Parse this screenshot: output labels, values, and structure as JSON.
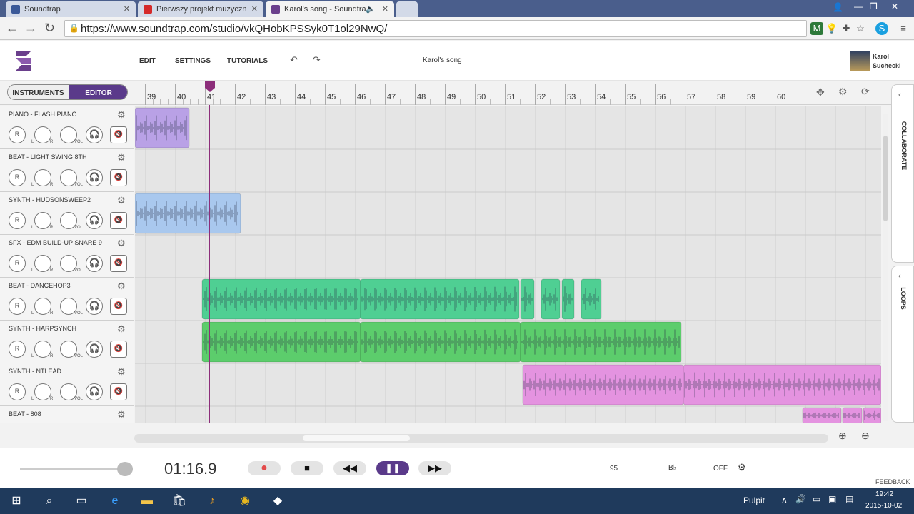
{
  "browser": {
    "tabs": [
      {
        "label": "Soundtrap",
        "active": false
      },
      {
        "label": "Pierwszy projekt muzyczn",
        "active": false
      },
      {
        "label": "Karol's song - Soundtra",
        "active": true
      }
    ],
    "url": "https://www.soundtrap.com/studio/vkQHobKPSSyk0T1ol29NwQ/"
  },
  "header": {
    "menu": [
      "EDIT",
      "SETTINGS",
      "TUTORIALS"
    ],
    "song_title": "Karol's song",
    "user_first": "Karol",
    "user_last": "Suchecki"
  },
  "toggle": {
    "instruments": "INSTRUMENTS",
    "editor": "EDITOR"
  },
  "ruler": [
    "39",
    "40",
    "41",
    "42",
    "43",
    "44",
    "45",
    "46",
    "47",
    "48",
    "49",
    "50",
    "51",
    "52",
    "53",
    "54",
    "55",
    "56",
    "57",
    "58",
    "59",
    "60"
  ],
  "side_panels": {
    "collaborate": "COLLABORATE",
    "loops": "LOOPS"
  },
  "tracks": [
    {
      "name": "PIANO - FLASH PIANO"
    },
    {
      "name": "BEAT - LIGHT SWING 8TH"
    },
    {
      "name": "SYNTH - HUDSONSWEEP2"
    },
    {
      "name": "SFX - EDM BUILD-UP SNARE 9"
    },
    {
      "name": "BEAT - DANCEHOP3"
    },
    {
      "name": "SYNTH - HARPSYNCH"
    },
    {
      "name": "SYNTH - NTLEAD"
    },
    {
      "name": "BEAT - 808"
    }
  ],
  "control_labels": {
    "rec": "R",
    "l": "L",
    "r": "R",
    "vol": "VOL"
  },
  "transport": {
    "time": "01:16.9",
    "tempo": "95",
    "key": "B♭",
    "metronome": "OFF",
    "feedback": "FEEDBACK"
  },
  "taskbar": {
    "location": "Pulpit",
    "time": "19:42",
    "date": "2015-10-02"
  },
  "colors": {
    "brand": "#6a3f8c",
    "clip_purple": "#b9a1e6",
    "clip_blue": "#a9c8ee",
    "clip_teal": "#4fcf93",
    "clip_green": "#5ccd6c",
    "clip_pink": "#e493e0",
    "playhead": "#8c2d7a"
  }
}
